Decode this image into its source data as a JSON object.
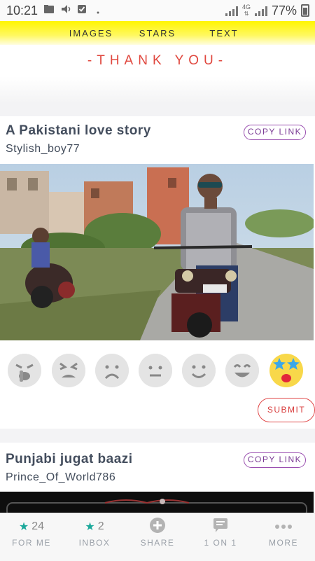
{
  "status_bar": {
    "time": "10:21",
    "network": "4G",
    "battery": "77%"
  },
  "top_tabs": [
    "IMAGES",
    "STARS",
    "TEXT"
  ],
  "banner": "-THANK YOU-",
  "posts": [
    {
      "title": "A Pakistani love story",
      "user": "Stylish_boy77",
      "copy_label": "COPY LINK"
    },
    {
      "title": "Punjabi jugat baazi",
      "user": "Prince_Of_World786",
      "copy_label": "COPY LINK"
    }
  ],
  "reactions": [
    {
      "icon": "crying-face-icon",
      "selected": false
    },
    {
      "icon": "squinting-face-icon",
      "selected": false
    },
    {
      "icon": "frowning-face-icon",
      "selected": false
    },
    {
      "icon": "neutral-face-icon",
      "selected": false
    },
    {
      "icon": "smiling-face-icon",
      "selected": false
    },
    {
      "icon": "grinning-face-icon",
      "selected": false
    },
    {
      "icon": "star-struck-face-icon",
      "selected": true
    }
  ],
  "submit_label": "SUBMIT",
  "bottom_nav": [
    {
      "label": "FOR ME",
      "count": "24",
      "icon": "star-icon"
    },
    {
      "label": "INBOX",
      "count": "2",
      "icon": "star-icon"
    },
    {
      "label": "SHARE",
      "count": "",
      "icon": "plus-circle-icon"
    },
    {
      "label": "1 ON 1",
      "count": "",
      "icon": "chat-bubble-icon"
    },
    {
      "label": "MORE",
      "count": "",
      "icon": "dots-icon"
    }
  ],
  "colors": {
    "accent_purple": "#9a4fb0",
    "submit_red": "#e04a4a",
    "banner_red": "#e0473e",
    "top_bar_yellow": "#fff500",
    "nav_teal": "#1aa89a"
  }
}
